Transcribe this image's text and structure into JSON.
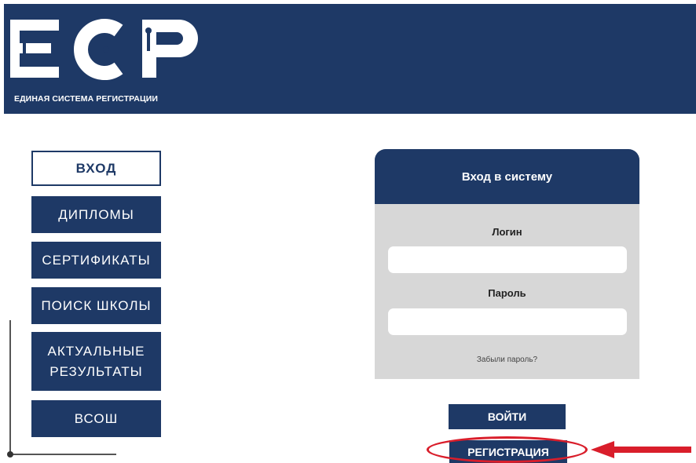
{
  "header": {
    "logo_text": "ЕСР",
    "tagline": "ЕДИНАЯ СИСТЕМА РЕГИСТРАЦИИ"
  },
  "nav": {
    "login": "ВХОД",
    "diplomas": "ДИПЛОМЫ",
    "certificates": "СЕРТИФИКАТЫ",
    "school_search": "ПОИСК ШКОЛЫ",
    "results": "АКТУАЛЬНЫЕ\nРЕЗУЛЬТАТЫ",
    "vsosh": "ВСОШ"
  },
  "login_panel": {
    "title": "Вход в систему",
    "login_label": "Логин",
    "login_value": "",
    "password_label": "Пароль",
    "password_value": "",
    "forgot": "Забыли пароль?"
  },
  "actions": {
    "enter": "ВОЙТИ",
    "register": "РЕГИСТРАЦИЯ"
  },
  "colors": {
    "brand": "#1e3966",
    "highlight": "#d91e2b",
    "panel_bg": "#d7d7d7"
  }
}
